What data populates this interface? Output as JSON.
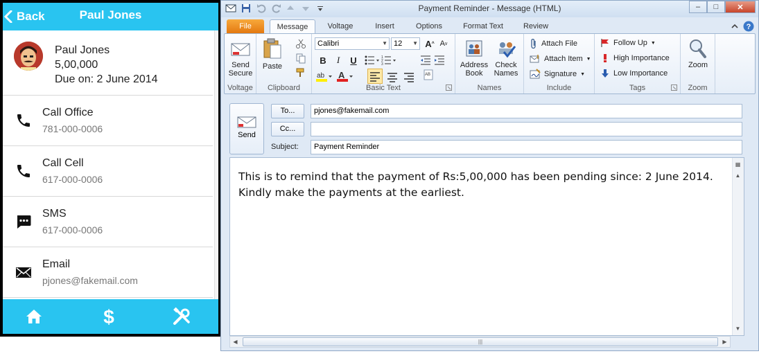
{
  "mobile": {
    "back_label": "Back",
    "title": "Paul Jones",
    "profile": {
      "name": "Paul Jones",
      "amount": "5,00,000",
      "due": "Due on: 2 June 2014"
    },
    "rows": [
      {
        "label": "Call Office",
        "sub": "781-000-0006",
        "icon": "phone-icon"
      },
      {
        "label": "Call Cell",
        "sub": "617-000-0006",
        "icon": "phone-icon"
      },
      {
        "label": "SMS",
        "sub": "617-000-0006",
        "icon": "sms-icon"
      },
      {
        "label": "Email",
        "sub": "pjones@fakemail.com",
        "icon": "mail-icon"
      }
    ],
    "footer_icons": [
      "home-icon",
      "dollar-icon",
      "tools-icon"
    ],
    "accent": "#29c4f0"
  },
  "outlook": {
    "window_title": "Payment Reminder  -  Message (HTML)",
    "tabs": [
      "File",
      "Message",
      "Voltage",
      "Insert",
      "Options",
      "Format Text",
      "Review"
    ],
    "active_tab": "Message",
    "groups": {
      "voltage": {
        "label": "Voltage",
        "send_secure": "Send\nSecure"
      },
      "clipboard": {
        "label": "Clipboard",
        "paste": "Paste"
      },
      "basic_text": {
        "label": "Basic Text",
        "font": "Calibri",
        "size": "12"
      },
      "names": {
        "label": "Names",
        "address_book": "Address\nBook",
        "check_names": "Check\nNames"
      },
      "include": {
        "label": "Include",
        "attach_file": "Attach File",
        "attach_item": "Attach Item",
        "signature": "Signature"
      },
      "tags": {
        "label": "Tags",
        "follow_up": "Follow Up",
        "high": "High Importance",
        "low": "Low Importance"
      },
      "zoom": {
        "label": "Zoom",
        "zoom": "Zoom"
      }
    },
    "send_label": "Send",
    "to_label": "To...",
    "cc_label": "Cc...",
    "subject_label": "Subject:",
    "to_value": "pjones@fakemail.com",
    "cc_value": "",
    "subject_value": "Payment Reminder",
    "body_line1": "This is to remind that the payment of Rs:5,00,000 has been pending since: 2 June 2014.",
    "body_line2": "Kindly make the payments at the earliest."
  }
}
